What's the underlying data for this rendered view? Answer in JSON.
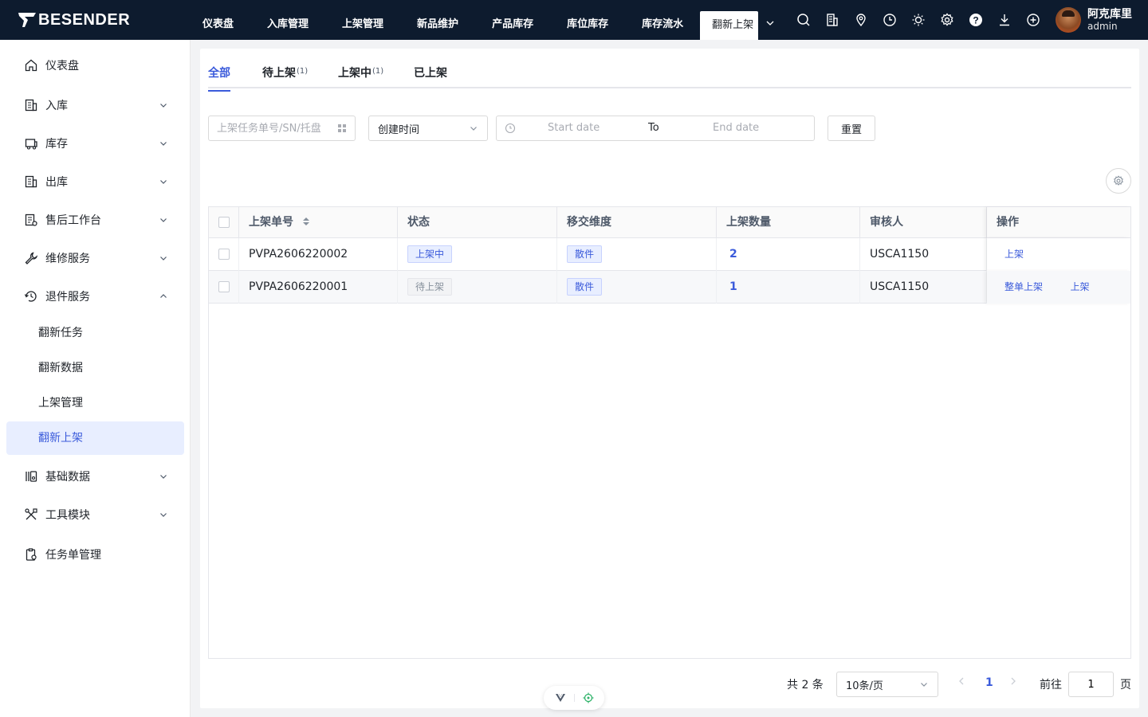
{
  "app": {
    "logo_text": "BESENDER",
    "brand_color": "#0d1b2e",
    "accent_color": "#3b5bdb"
  },
  "topnav": {
    "items": [
      {
        "label": "仪表盘"
      },
      {
        "label": "入库管理"
      },
      {
        "label": "上架管理"
      },
      {
        "label": "新品维护"
      },
      {
        "label": "产品库存"
      },
      {
        "label": "库位库存"
      },
      {
        "label": "库存流水"
      }
    ],
    "active_tab": "翻新上架",
    "icons": [
      "search-icon",
      "building-icon",
      "location-icon",
      "clock-icon",
      "sun-icon",
      "gear-icon",
      "help-icon",
      "download-icon",
      "plus-circle-icon"
    ]
  },
  "user": {
    "name": "阿克库里",
    "role": "admin"
  },
  "sidebar": {
    "items": [
      {
        "label": "仪表盘",
        "icon": "home-icon"
      },
      {
        "label": "入库",
        "icon": "inbound-icon"
      },
      {
        "label": "库存",
        "icon": "inventory-icon"
      },
      {
        "label": "出库",
        "icon": "outbound-icon"
      },
      {
        "label": "售后工作台",
        "icon": "aftersales-icon"
      },
      {
        "label": "维修服务",
        "icon": "wrench-icon"
      },
      {
        "label": "退件服务",
        "icon": "return-icon"
      },
      {
        "label": "基础数据",
        "icon": "data-icon"
      },
      {
        "label": "工具模块",
        "icon": "tools-icon"
      },
      {
        "label": "任务单管理",
        "icon": "task-icon"
      }
    ],
    "subitems": [
      {
        "label": "翻新任务"
      },
      {
        "label": "翻新数据"
      },
      {
        "label": "上架管理"
      },
      {
        "label": "翻新上架"
      }
    ]
  },
  "tabs": [
    {
      "label": "全部",
      "count": ""
    },
    {
      "label": "待上架",
      "count": "(1)"
    },
    {
      "label": "上架中",
      "count": "(1)"
    },
    {
      "label": "已上架",
      "count": ""
    }
  ],
  "filters": {
    "search_placeholder": "上架任务单号/SN/托盘",
    "time_type": "创建时间",
    "start_placeholder": "Start date",
    "range_separator": "To",
    "end_placeholder": "End date",
    "reset_label": "重置"
  },
  "table": {
    "columns": [
      "上架单号",
      "状态",
      "移交维度",
      "上架数量",
      "审核人",
      "操作"
    ],
    "rows": [
      {
        "id": "PVPA2606220002",
        "status": "上架中",
        "dimension": "散件",
        "qty": "2",
        "reviewer": "USCA1150",
        "actions": [
          "上架"
        ]
      },
      {
        "id": "PVPA2606220001",
        "status": "待上架",
        "dimension": "散件",
        "qty": "1",
        "reviewer": "USCA1150",
        "actions": [
          "整单上架",
          "上架"
        ]
      }
    ]
  },
  "pagination": {
    "total": "共 2 条",
    "page_size": "10条/页",
    "current": "1",
    "goto_label": "前往",
    "goto_value": "1",
    "page_suffix": "页"
  }
}
